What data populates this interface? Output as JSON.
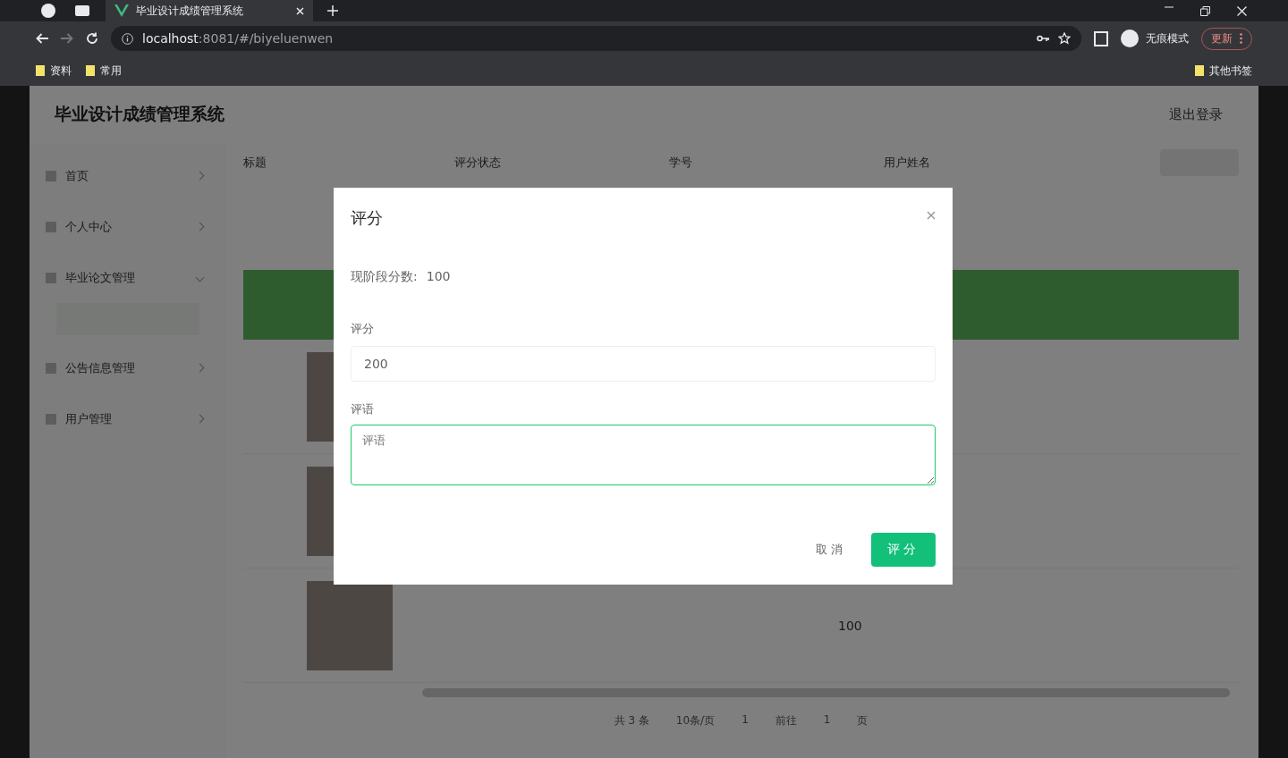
{
  "browser": {
    "tab_title": "毕业设计成绩管理系统",
    "url_host": "localhost",
    "url_rest": ":8081/#/biyeluenwen",
    "incognito_label": "无痕模式",
    "update_label": "更新",
    "bookmarks": [
      "资料",
      "常用"
    ],
    "other_bookmarks": "其他书签"
  },
  "app": {
    "title": "毕业设计成绩管理系统",
    "logout": "退出登录"
  },
  "sidebar": {
    "items": [
      {
        "label": "首页",
        "expanded": false
      },
      {
        "label": "个人中心",
        "expanded": false
      },
      {
        "label": "毕业论文管理",
        "expanded": true
      },
      {
        "label": "公告信息管理",
        "expanded": false
      },
      {
        "label": "用户管理",
        "expanded": false
      }
    ]
  },
  "table": {
    "columns": [
      "标题",
      "评分状态",
      "学号",
      "用户姓名"
    ],
    "rows": [
      {
        "score": ""
      },
      {
        "score": ""
      },
      {
        "score": "100"
      }
    ]
  },
  "pagination": {
    "total": "共 3 条",
    "page_size": "10条/页",
    "current": "1",
    "goto_label": "前往",
    "goto_value": "1",
    "page_suffix": "页"
  },
  "dialog": {
    "title": "评分",
    "stage_label": "现阶段分数:",
    "stage_value": "100",
    "score_label": "评分",
    "score_value": "200",
    "comment_label": "评语",
    "comment_placeholder": "评语",
    "cancel": "取消",
    "submit": "评分"
  }
}
